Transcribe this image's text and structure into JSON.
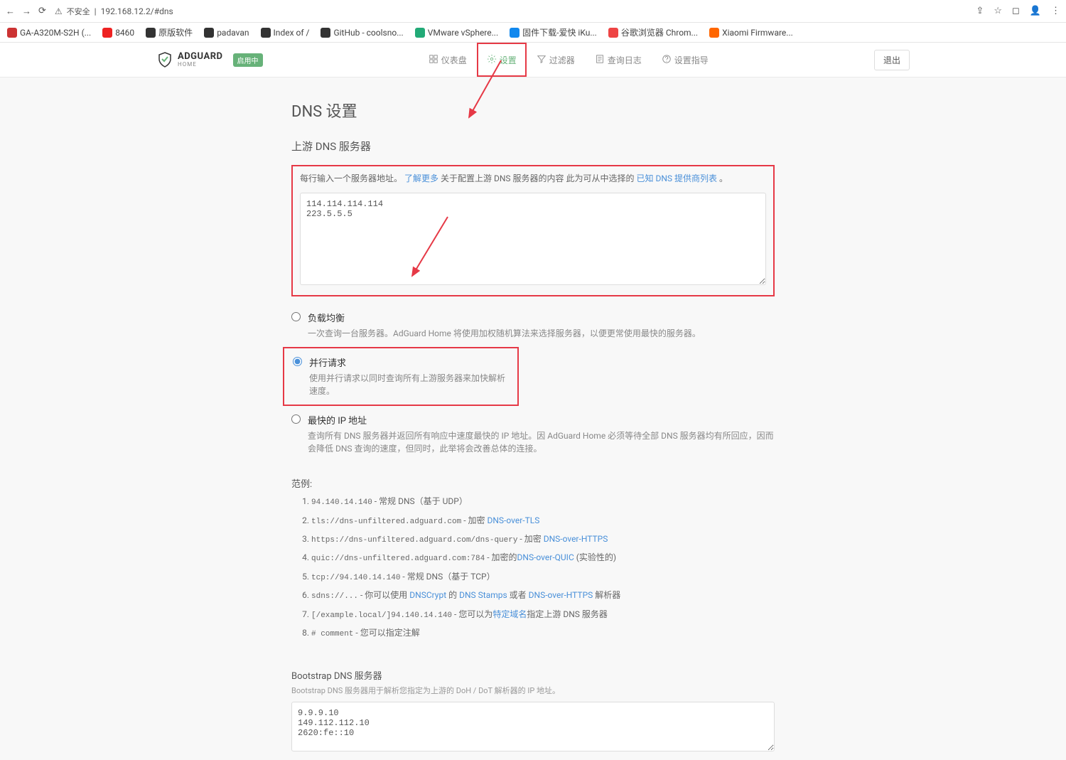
{
  "browser": {
    "url": "192.168.12.2/#dns",
    "insecure": "不安全"
  },
  "bookmarks": [
    {
      "label": "GA-A320M-S2H (...",
      "color": "#c33"
    },
    {
      "label": "8460",
      "color": "#e22"
    },
    {
      "label": "原版软件",
      "color": "#333"
    },
    {
      "label": "padavan",
      "color": "#333"
    },
    {
      "label": "Index of /",
      "color": "#333"
    },
    {
      "label": "GitHub - coolsno...",
      "color": "#333"
    },
    {
      "label": "VMware vSphere...",
      "color": "#2a7"
    },
    {
      "label": "固件下载-爱快 iKu...",
      "color": "#18e"
    },
    {
      "label": "谷歌浏览器 Chrom...",
      "color": "#e44"
    },
    {
      "label": "Xiaomi Firmware...",
      "color": "#f60"
    }
  ],
  "header": {
    "brand": "ADGUARD",
    "brand_sub": "HOME",
    "badge": "启用中",
    "nav": [
      {
        "label": "仪表盘",
        "icon": "dashboard"
      },
      {
        "label": "设置",
        "icon": "settings",
        "active": true,
        "highlight": true
      },
      {
        "label": "过滤器",
        "icon": "filter"
      },
      {
        "label": "查询日志",
        "icon": "log"
      },
      {
        "label": "设置指导",
        "icon": "guide"
      }
    ],
    "logout": "退出"
  },
  "page": {
    "title": "DNS 设置",
    "upstream_title": "上游 DNS 服务器",
    "hint_pre": "每行输入一个服务器地址。",
    "hint_link1": "了解更多",
    "hint_mid": "关于配置上游 DNS 服务器的内容 此为可从中选择的",
    "hint_link2": "已知 DNS 提供商列表",
    "hint_post": "。",
    "upstream_value": "114.114.114.114\n223.5.5.5",
    "modes": [
      {
        "title": "负载均衡",
        "desc": "一次查询一台服务器。AdGuard Home 将使用加权随机算法来选择服务器，以便更常使用最快的服务器。",
        "checked": false
      },
      {
        "title": "并行请求",
        "desc": "使用并行请求以同时查询所有上游服务器来加快解析速度。",
        "checked": true,
        "boxed": true
      },
      {
        "title": "最快的 IP 地址",
        "desc": "查询所有 DNS 服务器并返回所有响应中速度最快的 IP 地址。因 AdGuard Home 必须等待全部 DNS 服务器均有所回应，因而会降低 DNS 查询的速度，但同时，此举将会改善总体的连接。",
        "checked": false
      }
    ],
    "examples_title": "范例:",
    "examples": [
      {
        "code": "94.140.14.140",
        "text": " - 常规 DNS（基于 UDP）"
      },
      {
        "code": "tls://dns-unfiltered.adguard.com",
        "text": " - 加密 ",
        "link": "DNS-over-TLS"
      },
      {
        "code": "https://dns-unfiltered.adguard.com/dns-query",
        "text": " - 加密 ",
        "link": "DNS-over-HTTPS"
      },
      {
        "code": "quic://dns-unfiltered.adguard.com:784",
        "text": " - 加密的",
        "link": "DNS-over-QUIC",
        "extra": " (实验性的)"
      },
      {
        "code": "tcp://94.140.14.140",
        "text": " - 常规 DNS（基于 TCP）"
      },
      {
        "code": "sdns://...",
        "text": " - 你可以使用 ",
        "link": "DNSCrypt",
        "mid": " 的 ",
        "link2": "DNS Stamps",
        "mid2": " 或者 ",
        "link3": "DNS-over-HTTPS",
        "extra": " 解析器"
      },
      {
        "code": "[/example.local/]94.140.14.140",
        "text": " - 您可以为",
        "link": "特定域名",
        "extra": "指定上游 DNS 服务器"
      },
      {
        "code": "# comment",
        "text": " - 您可以指定注解"
      }
    ],
    "bootstrap_title": "Bootstrap DNS 服务器",
    "bootstrap_hint": "Bootstrap DNS 服务器用于解析您指定为上游的 DoH / DoT 解析器的 IP 地址。",
    "bootstrap_value": "9.9.9.10\n149.112.112.10\n2620:fe::10"
  }
}
